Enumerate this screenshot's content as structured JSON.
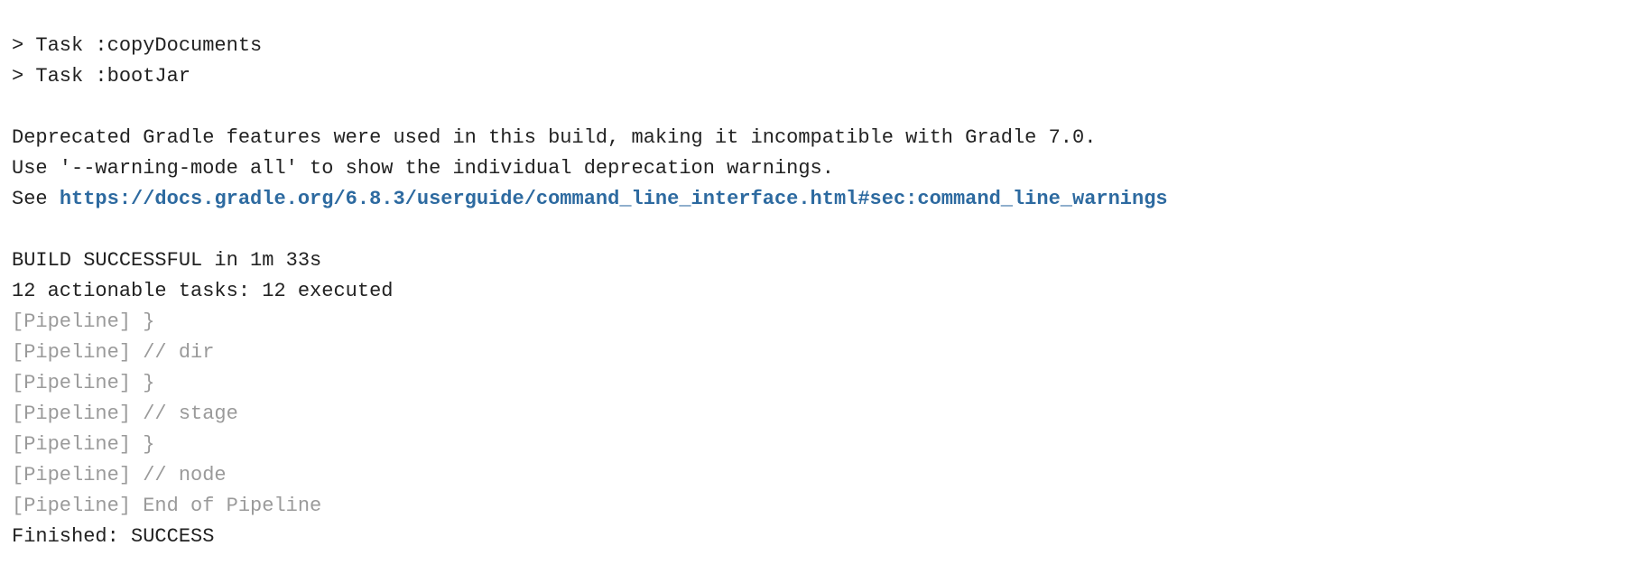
{
  "console": {
    "task_copy": "> Task :copyDocuments",
    "task_bootjar": "> Task :bootJar",
    "deprecated": "Deprecated Gradle features were used in this build, making it incompatible with Gradle 7.0.",
    "warning_mode": "Use '--warning-mode all' to show the individual deprecation warnings.",
    "see_prefix": "See ",
    "see_link": "https://docs.gradle.org/6.8.3/userguide/command_line_interface.html#sec:command_line_warnings",
    "build_result": "BUILD SUCCESSFUL in 1m 33s",
    "tasks_summary": "12 actionable tasks: 12 executed",
    "pipeline_lines": [
      "[Pipeline] }",
      "[Pipeline] // dir",
      "[Pipeline] }",
      "[Pipeline] // stage",
      "[Pipeline] }",
      "[Pipeline] // node",
      "[Pipeline] End of Pipeline"
    ],
    "finished": "Finished: SUCCESS"
  },
  "colors": {
    "text": "#222222",
    "pipeline_text": "#9a9a9a",
    "link": "#2d6aa0",
    "background": "#ffffff"
  }
}
